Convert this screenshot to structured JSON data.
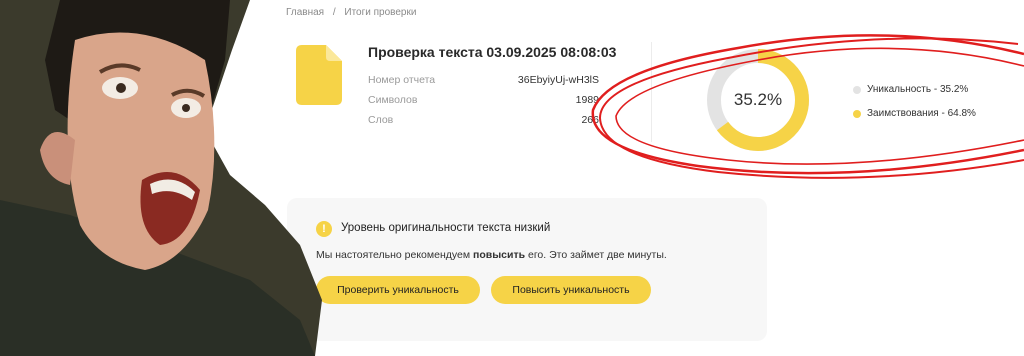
{
  "breadcrumb": {
    "home": "Главная",
    "separator": "/",
    "current": "Итоги проверки"
  },
  "report": {
    "title": "Проверка текста 03.09.2025 08:08:03",
    "fields": [
      {
        "label": "Номер отчета",
        "value": "36EbyiyUj-wH3lS"
      },
      {
        "label": "Символов",
        "value": "1989"
      },
      {
        "label": "Слов",
        "value": "266"
      }
    ]
  },
  "result": {
    "center_label": "35.2%",
    "uniqueness_percent": 35.2,
    "borrowing_percent": 64.8,
    "legend": [
      {
        "label": "Уникальность - 35.2%",
        "color": "#e3e3e3"
      },
      {
        "label": "Заимствования - 64.8%",
        "color": "#f6d347"
      }
    ]
  },
  "notice": {
    "icon": "exclamation-icon",
    "title": "Уровень оригинальности текста низкий",
    "text_before": "Мы настоятельно рекомендуем ",
    "text_bold": "повысить",
    "text_after": " его. Это займет две минуты.",
    "buttons": {
      "check": "Проверить уникальность",
      "improve": "Повысить уникальность"
    }
  },
  "colors": {
    "accent": "#f6d347",
    "track": "#e3e3e3",
    "scribble": "#e01e1e"
  }
}
